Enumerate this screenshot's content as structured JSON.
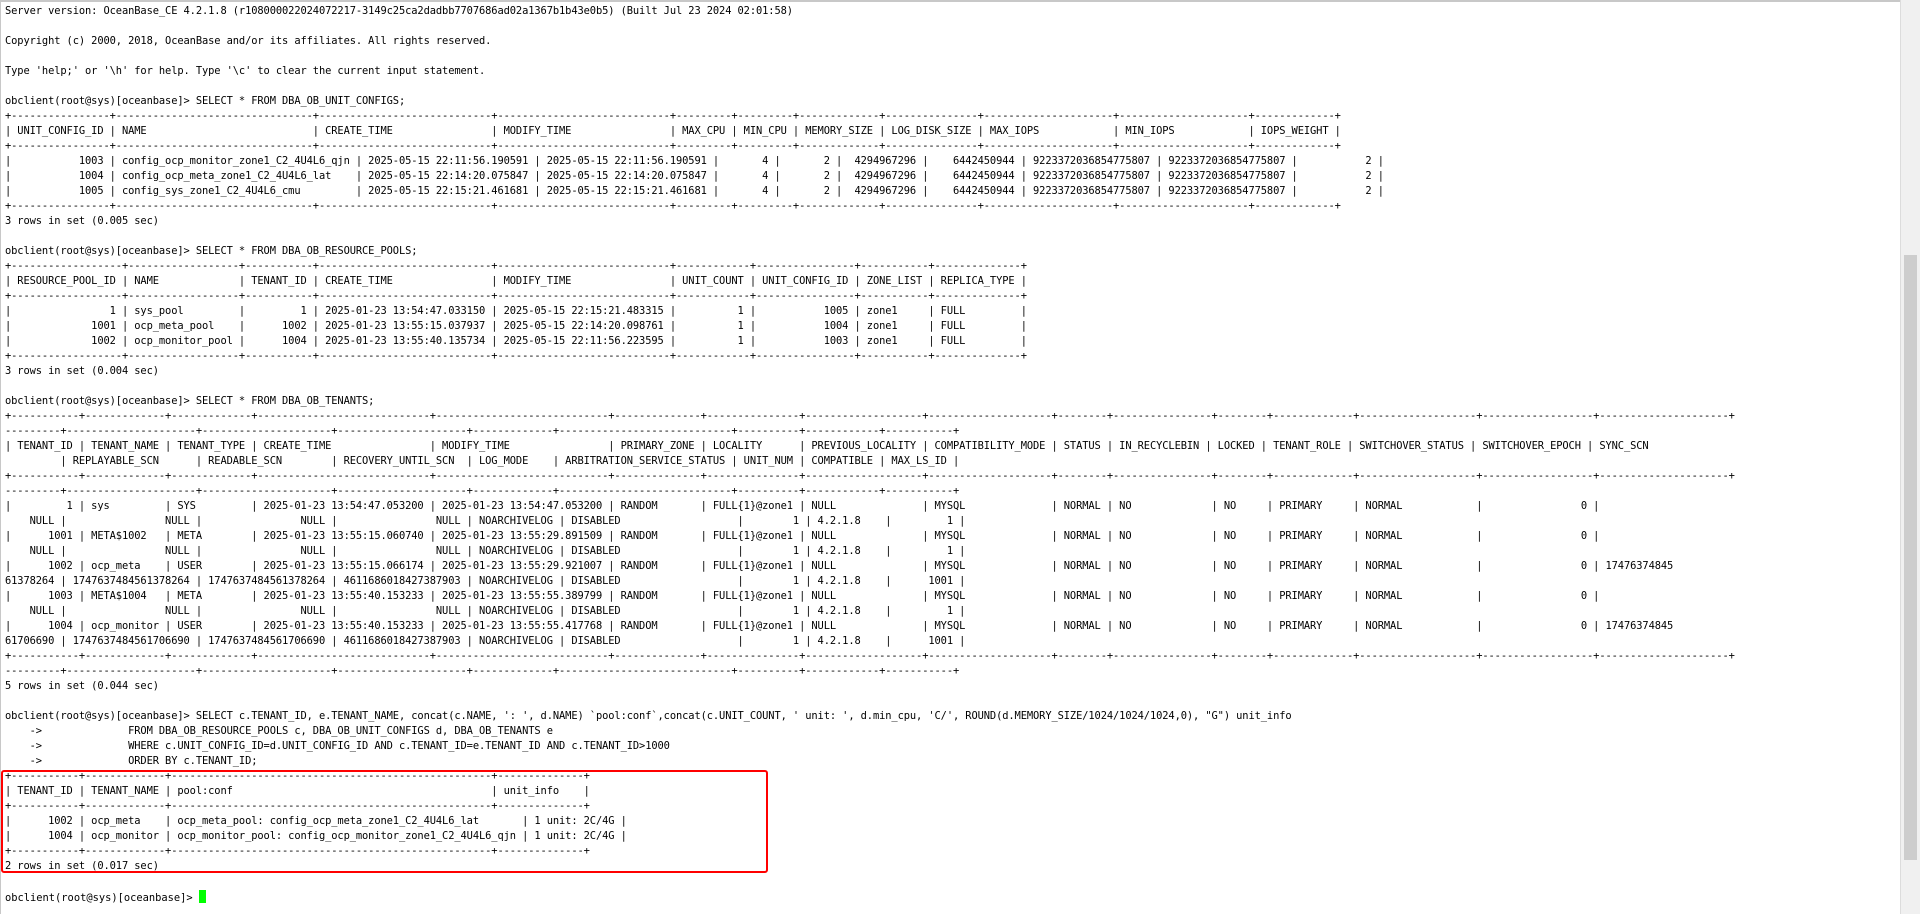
{
  "terminal": {
    "lines": [
      "Server version: OceanBase_CE 4.2.1.8 (r108000022024072217-3149c25ca2dadbb7707686ad02a1367b1b43e0b5) (Built Jul 23 2024 02:01:58)",
      "",
      "Copyright (c) 2000, 2018, OceanBase and/or its affiliates. All rights reserved.",
      "",
      "Type 'help;' or '\\h' for help. Type '\\c' to clear the current input statement.",
      "",
      "obclient(root@sys)[oceanbase]> SELECT * FROM DBA_OB_UNIT_CONFIGS;",
      "+----------------+--------------------------------+----------------------------+----------------------------+---------+---------+-------------+---------------+---------------------+---------------------+-------------+",
      "| UNIT_CONFIG_ID | NAME                           | CREATE_TIME                | MODIFY_TIME                | MAX_CPU | MIN_CPU | MEMORY_SIZE | LOG_DISK_SIZE | MAX_IOPS            | MIN_IOPS            | IOPS_WEIGHT |",
      "+----------------+--------------------------------+----------------------------+----------------------------+---------+---------+-------------+---------------+---------------------+---------------------+-------------+",
      "|           1003 | config_ocp_monitor_zone1_C2_4U4L6_qjn | 2025-05-15 22:11:56.190591 | 2025-05-15 22:11:56.190591 |       4 |       2 |  4294967296 |    6442450944 | 9223372036854775807 | 9223372036854775807 |           2 |",
      "|           1004 | config_ocp_meta_zone1_C2_4U4L6_lat    | 2025-05-15 22:14:20.075847 | 2025-05-15 22:14:20.075847 |       4 |       2 |  4294967296 |    6442450944 | 9223372036854775807 | 9223372036854775807 |           2 |",
      "|           1005 | config_sys_zone1_C2_4U4L6_cmu         | 2025-05-15 22:15:21.461681 | 2025-05-15 22:15:21.461681 |       4 |       2 |  4294967296 |    6442450944 | 9223372036854775807 | 9223372036854775807 |           2 |",
      "+----------------+--------------------------------+----------------------------+----------------------------+---------+---------+-------------+---------------+---------------------+---------------------+-------------+",
      "3 rows in set (0.005 sec)",
      "",
      "obclient(root@sys)[oceanbase]> SELECT * FROM DBA_OB_RESOURCE_POOLS;",
      "+------------------+------------------+-----------+----------------------------+----------------------------+------------+----------------+-----------+--------------+",
      "| RESOURCE_POOL_ID | NAME             | TENANT_ID | CREATE_TIME                | MODIFY_TIME                | UNIT_COUNT | UNIT_CONFIG_ID | ZONE_LIST | REPLICA_TYPE |",
      "+------------------+------------------+-----------+----------------------------+----------------------------+------------+----------------+-----------+--------------+",
      "|                1 | sys_pool         |         1 | 2025-01-23 13:54:47.033150 | 2025-05-15 22:15:21.483315 |          1 |           1005 | zone1     | FULL         |",
      "|             1001 | ocp_meta_pool    |      1002 | 2025-01-23 13:55:15.037937 | 2025-05-15 22:14:20.098761 |          1 |           1004 | zone1     | FULL         |",
      "|             1002 | ocp_monitor_pool |      1004 | 2025-01-23 13:55:40.135734 | 2025-05-15 22:11:56.223595 |          1 |           1003 | zone1     | FULL         |",
      "+------------------+------------------+-----------+----------------------------+----------------------------+------------+----------------+-----------+--------------+",
      "3 rows in set (0.004 sec)",
      "",
      "obclient(root@sys)[oceanbase]> SELECT * FROM DBA_OB_TENANTS;",
      "+-----------+-------------+-------------+----------------------------+----------------------------+--------------+---------------+-------------------+--------------------+--------+----------------+--------+-------------+-------------------+------------------+---------------------+",
      "---------+---------------------+---------------------+---------------------+-------------+----------------------------+----------+------------+-----------+",
      "| TENANT_ID | TENANT_NAME | TENANT_TYPE | CREATE_TIME                | MODIFY_TIME                | PRIMARY_ZONE | LOCALITY      | PREVIOUS_LOCALITY | COMPATIBILITY_MODE | STATUS | IN_RECYCLEBIN | LOCKED | TENANT_ROLE | SWITCHOVER_STATUS | SWITCHOVER_EPOCH | SYNC_SCN",
      "         | REPLAYABLE_SCN      | READABLE_SCN        | RECOVERY_UNTIL_SCN  | LOG_MODE    | ARBITRATION_SERVICE_STATUS | UNIT_NUM | COMPATIBLE | MAX_LS_ID |",
      "+-----------+-------------+-------------+----------------------------+----------------------------+--------------+---------------+-------------------+--------------------+--------+----------------+--------+-------------+-------------------+------------------+---------------------+",
      "---------+---------------------+---------------------+---------------------+-------------+----------------------------+----------+------------+-----------+",
      "|         1 | sys         | SYS         | 2025-01-23 13:54:47.053200 | 2025-01-23 13:54:47.053200 | RANDOM       | FULL{1}@zone1 | NULL              | MYSQL              | NORMAL | NO             | NO     | PRIMARY     | NORMAL            |                0 |",
      "    NULL |                NULL |                NULL |                NULL | NOARCHIVELOG | DISABLED                   |        1 | 4.2.1.8    |         1 |",
      "|      1001 | META$1002   | META        | 2025-01-23 13:55:15.060740 | 2025-01-23 13:55:29.891509 | RANDOM       | FULL{1}@zone1 | NULL              | MYSQL              | NORMAL | NO             | NO     | PRIMARY     | NORMAL            |                0 |",
      "    NULL |                NULL |                NULL |                NULL | NOARCHIVELOG | DISABLED                   |        1 | 4.2.1.8    |         1 |",
      "|      1002 | ocp_meta    | USER        | 2025-01-23 13:55:15.066174 | 2025-01-23 13:55:29.921007 | RANDOM       | FULL{1}@zone1 | NULL              | MYSQL              | NORMAL | NO             | NO     | PRIMARY     | NORMAL            |                0 | 17476374845",
      "61378264 | 1747637484561378264 | 1747637484561378264 | 4611686018427387903 | NOARCHIVELOG | DISABLED                   |        1 | 4.2.1.8    |      1001 |",
      "|      1003 | META$1004   | META        | 2025-01-23 13:55:40.153233 | 2025-01-23 13:55:55.389799 | RANDOM       | FULL{1}@zone1 | NULL              | MYSQL              | NORMAL | NO             | NO     | PRIMARY     | NORMAL            |                0 |",
      "    NULL |                NULL |                NULL |                NULL | NOARCHIVELOG | DISABLED                   |        1 | 4.2.1.8    |         1 |",
      "|      1004 | ocp_monitor | USER        | 2025-01-23 13:55:40.153233 | 2025-01-23 13:55:55.417768 | RANDOM       | FULL{1}@zone1 | NULL              | MYSQL              | NORMAL | NO             | NO     | PRIMARY     | NORMAL            |                0 | 17476374845",
      "61706690 | 1747637484561706690 | 1747637484561706690 | 4611686018427387903 | NOARCHIVELOG | DISABLED                   |        1 | 4.2.1.8    |      1001 |",
      "+-----------+-------------+-------------+----------------------------+----------------------------+--------------+---------------+-------------------+--------------------+--------+----------------+--------+-------------+-------------------+------------------+---------------------+",
      "---------+---------------------+---------------------+---------------------+-------------+----------------------------+----------+------------+-----------+",
      "5 rows in set (0.044 sec)",
      "",
      "obclient(root@sys)[oceanbase]> SELECT c.TENANT_ID, e.TENANT_NAME, concat(c.NAME, ': ', d.NAME) `pool:conf`,concat(c.UNIT_COUNT, ' unit: ', d.min_cpu, 'C/', ROUND(d.MEMORY_SIZE/1024/1024/1024,0), \"G\") unit_info",
      "    ->              FROM DBA_OB_RESOURCE_POOLS c, DBA_OB_UNIT_CONFIGS d, DBA_OB_TENANTS e",
      "    ->              WHERE c.UNIT_CONFIG_ID=d.UNIT_CONFIG_ID AND c.TENANT_ID=e.TENANT_ID AND c.TENANT_ID>1000",
      "    ->              ORDER BY c.TENANT_ID;",
      "+-----------+-------------+----------------------------------------------------+--------------+",
      "| TENANT_ID | TENANT_NAME | pool:conf                                          | unit_info    |",
      "+-----------+-------------+----------------------------------------------------+--------------+",
      "|      1002 | ocp_meta    | ocp_meta_pool: config_ocp_meta_zone1_C2_4U4L6_lat       | 1 unit: 2C/4G |",
      "|      1004 | ocp_monitor | ocp_monitor_pool: config_ocp_monitor_zone1_C2_4U4L6_qjn | 1 unit: 2C/4G |",
      "+-----------+-------------+----------------------------------------------------+--------------+",
      "2 rows in set (0.017 sec)"
    ],
    "prompt": "obclient(root@sys)[oceanbase]>"
  }
}
